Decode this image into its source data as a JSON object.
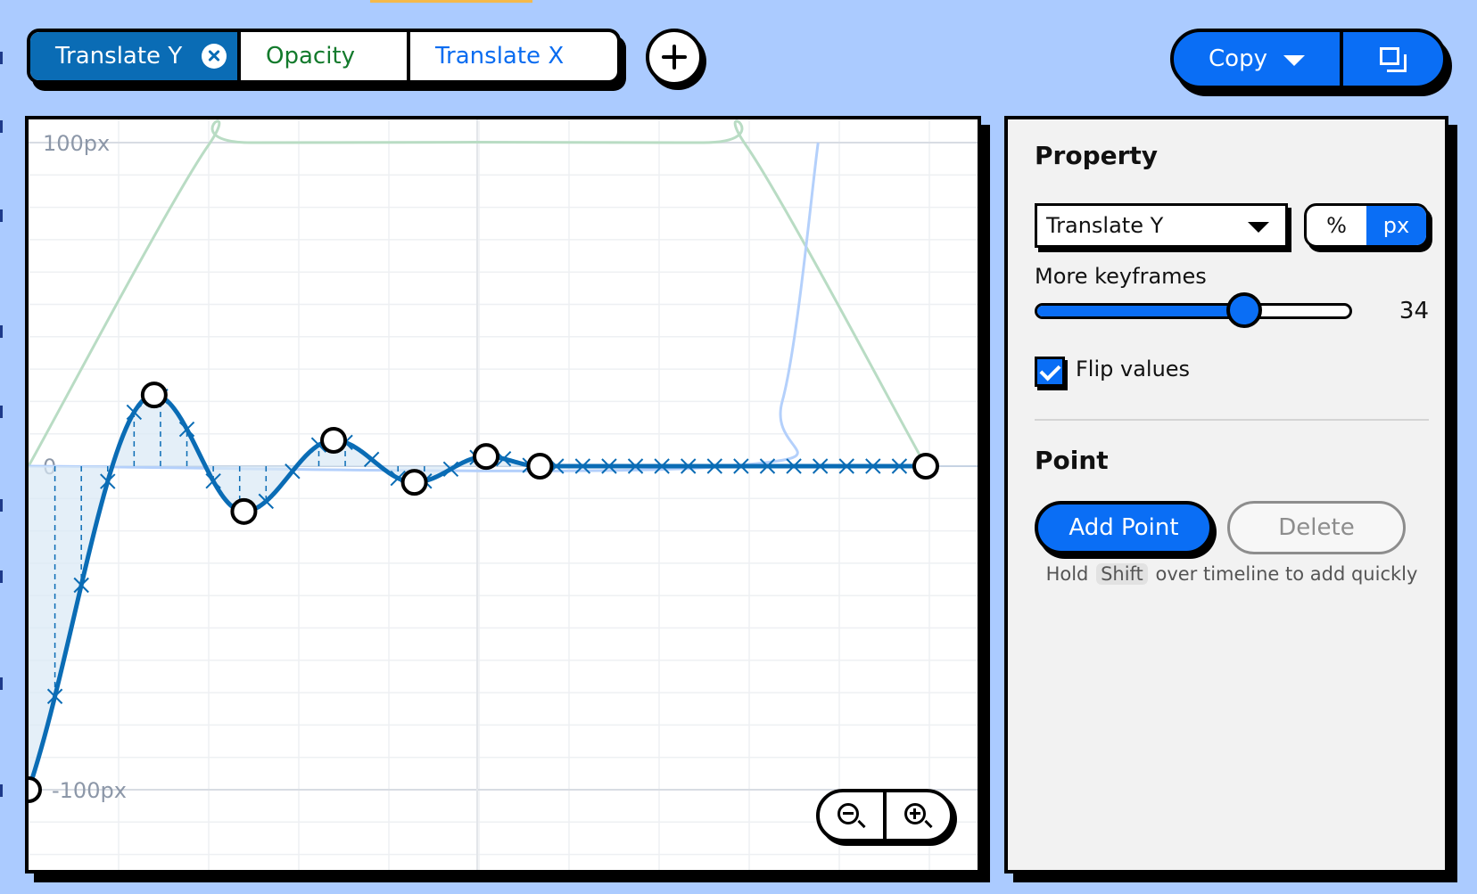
{
  "tabs": [
    {
      "label": "Translate Y",
      "active": true
    },
    {
      "label": "Opacity"
    },
    {
      "label": "Translate X"
    }
  ],
  "toolbar": {
    "copy_label": "Copy"
  },
  "graph": {
    "y_top_label": "100px",
    "y_zero_label": "0",
    "y_bottom_label": "-100px"
  },
  "chart_data": {
    "type": "line",
    "ylim": [
      -100,
      100
    ],
    "xlim": [
      0,
      1
    ],
    "series": [
      {
        "role": "active",
        "color": "#0a6cb5",
        "keyframes": [
          {
            "x": 0.0,
            "y": -100
          },
          {
            "x": 0.14,
            "y": 22
          },
          {
            "x": 0.24,
            "y": -14
          },
          {
            "x": 0.34,
            "y": 8
          },
          {
            "x": 0.43,
            "y": -5
          },
          {
            "x": 0.51,
            "y": 3
          },
          {
            "x": 0.57,
            "y": 0
          },
          {
            "x": 1.0,
            "y": 0
          }
        ]
      },
      {
        "role": "background",
        "color": "#b9dcc4",
        "points": [
          {
            "x": 0.0,
            "y": 0
          },
          {
            "x": 0.2,
            "y": 99
          },
          {
            "x": 0.25,
            "y": 100
          },
          {
            "x": 0.75,
            "y": 100
          },
          {
            "x": 0.8,
            "y": 99
          },
          {
            "x": 1.0,
            "y": 0
          }
        ]
      },
      {
        "role": "background",
        "color": "#b4d0fb",
        "points": [
          {
            "x": 0.0,
            "y": 0
          },
          {
            "x": 0.78,
            "y": 0
          },
          {
            "x": 0.84,
            "y": 20
          },
          {
            "x": 0.88,
            "y": 100
          }
        ]
      }
    ]
  },
  "panel": {
    "property_title": "Property",
    "property_value": "Translate Y",
    "units": [
      "%",
      "px"
    ],
    "active_unit": "px",
    "more_keyframes_label": "More keyframes",
    "keyframes_value": "34",
    "keyframes_fraction": 0.66,
    "flip_values_label": "Flip values",
    "flip_checked": true,
    "point_title": "Point",
    "add_point_label": "Add Point",
    "delete_label": "Delete",
    "hint_before": "Hold",
    "hint_key": "Shift",
    "hint_after": "over timeline to add quickly"
  }
}
